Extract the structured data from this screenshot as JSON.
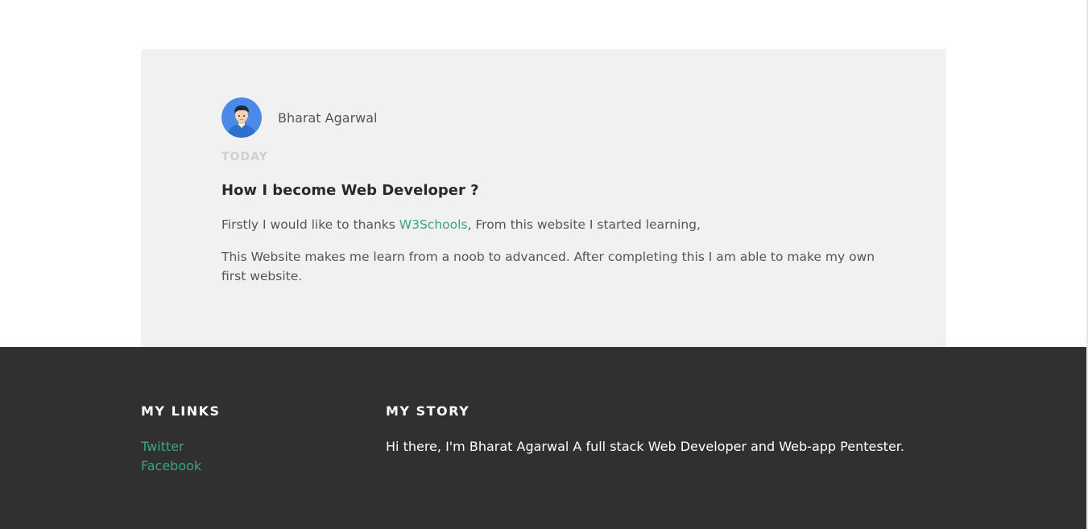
{
  "post": {
    "author_name": "Bharat Agarwal",
    "avatar_icon": "user-avatar-icon",
    "date": "TODAY",
    "title": "How I become Web Developer ?",
    "para1_before": "Firstly I would like to thanks ",
    "para1_link": "W3Schools",
    "para1_after": ", From this website I started learning,",
    "para2": "This Website makes me learn from a noob to advanced. After completing this I am able to make my own first website."
  },
  "footer": {
    "links_heading": "MY LINKS",
    "links": [
      {
        "label": "Twitter"
      },
      {
        "label": "Facebook"
      }
    ],
    "story_heading": "MY STORY",
    "story_text": "Hi there, I'm Bharat Agarwal A full stack Web Developer and Web-app Pentester."
  },
  "colors": {
    "accent": "#3aa387",
    "footer_bg": "#303030",
    "card_bg": "#f1f1f1"
  }
}
